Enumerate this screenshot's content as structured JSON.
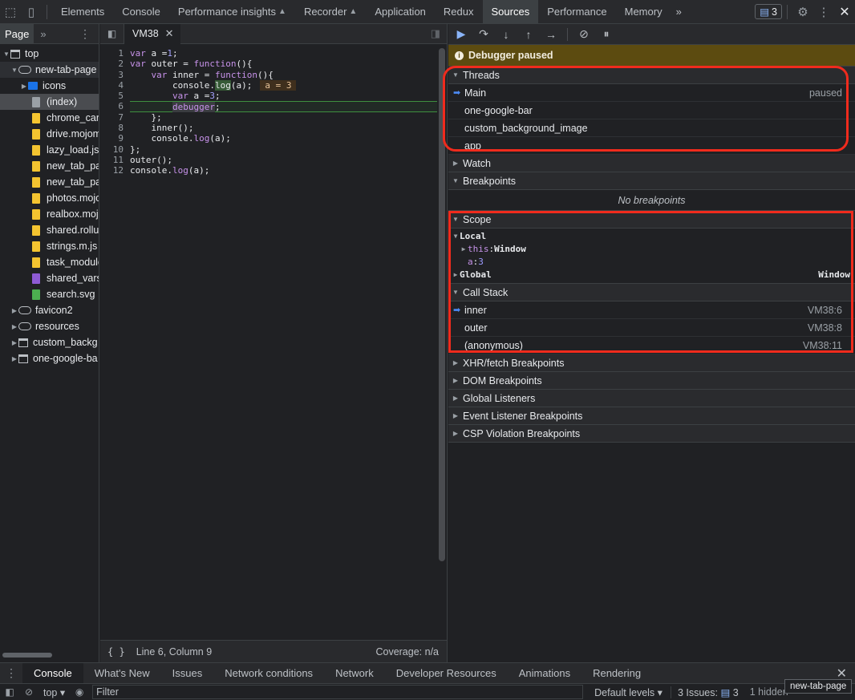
{
  "top_tabs": {
    "elements": "Elements",
    "console": "Console",
    "performance_insights": "Performance insights",
    "recorder": "Recorder",
    "application": "Application",
    "redux": "Redux",
    "sources": "Sources",
    "performance": "Performance",
    "memory": "Memory",
    "more": "»",
    "issues_count": "3"
  },
  "navigator": {
    "tab": "Page",
    "more": "»",
    "tree": [
      {
        "label": "top"
      },
      {
        "label": "new-tab-page"
      },
      {
        "label": "icons"
      },
      {
        "label": "(index)"
      },
      {
        "label": "chrome_cart"
      },
      {
        "label": "drive.mojom"
      },
      {
        "label": "lazy_load.js"
      },
      {
        "label": "new_tab_pa"
      },
      {
        "label": "new_tab_pa"
      },
      {
        "label": "photos.mojo"
      },
      {
        "label": "realbox.mojo"
      },
      {
        "label": "shared.rollup"
      },
      {
        "label": "strings.m.js"
      },
      {
        "label": "task_module"
      },
      {
        "label": "shared_vars"
      },
      {
        "label": "search.svg"
      },
      {
        "label": "favicon2"
      },
      {
        "label": "resources"
      },
      {
        "label": "custom_backg"
      },
      {
        "label": "one-google-ba"
      }
    ]
  },
  "editor": {
    "file_tab": "VM38",
    "line_numbers": [
      "1",
      "2",
      "3",
      "4",
      "5",
      "6",
      "7",
      "8",
      "9",
      "10",
      "11",
      "12"
    ],
    "code": {
      "l1": "var a =1;",
      "l2a": "var outer = ",
      "l2b": "function",
      "l2c": "(){",
      "l3a": "    var inner = ",
      "l3b": "function",
      "l3c": "(){",
      "l4a": "        console.",
      "l4b": "log",
      "l4c": "(a);",
      "l4inline": "a = 3",
      "l5": "        var a =3;",
      "l6a": "        ",
      "l6b": "debugger",
      "l6c": ";",
      "l7": "    };",
      "l8": "    inner();",
      "l9a": "    console.",
      "l9b": "log",
      "l9c": "(a);",
      "l10": "};",
      "l11": "outer();",
      "l12a": "console.",
      "l12b": "log",
      "l12c": "(a);"
    },
    "status": {
      "braces": "{ }",
      "position": "Line 6, Column 9",
      "coverage": "Coverage: n/a"
    }
  },
  "debugger": {
    "paused_message": "Debugger paused",
    "threads": {
      "title": "Threads",
      "items": [
        {
          "name": "Main",
          "status": "paused"
        },
        {
          "name": "one-google-bar",
          "status": ""
        },
        {
          "name": "custom_background_image",
          "status": ""
        },
        {
          "name": "app",
          "status": ""
        }
      ]
    },
    "watch": "Watch",
    "breakpoints": {
      "title": "Breakpoints",
      "empty": "No breakpoints"
    },
    "scope": {
      "title": "Scope",
      "local": "Local",
      "this_key": "this",
      "this_val": "Window",
      "a_key": "a",
      "a_val": "3",
      "global": "Global",
      "global_val": "Window"
    },
    "call_stack": {
      "title": "Call Stack",
      "frames": [
        {
          "name": "inner",
          "location": "VM38:6"
        },
        {
          "name": "outer",
          "location": "VM38:8"
        },
        {
          "name": "(anonymous)",
          "location": "VM38:11"
        }
      ]
    },
    "more_sections": [
      "XHR/fetch Breakpoints",
      "DOM Breakpoints",
      "Global Listeners",
      "Event Listener Breakpoints",
      "CSP Violation Breakpoints"
    ]
  },
  "drawer": {
    "tabs": [
      "Console",
      "What's New",
      "Issues",
      "Network conditions",
      "Network",
      "Developer Resources",
      "Animations",
      "Rendering"
    ],
    "context": "top",
    "filter_placeholder": "Filter",
    "levels": "Default levels ▾",
    "issues_label": "3 Issues:",
    "issues_count": "3",
    "hidden_fragment": "1 hidden"
  },
  "tooltip": "new-tab-page",
  "colors": {
    "annotation": "#f02b1d",
    "paused_bar": "#5c4b10",
    "accent": "#8ab4f8"
  }
}
